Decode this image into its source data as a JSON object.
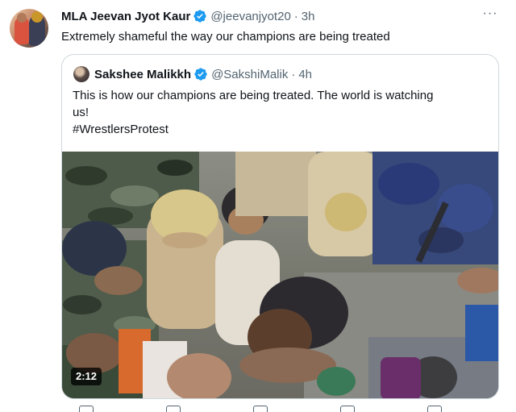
{
  "tweet": {
    "author_name": "MLA Jeevan Jyot Kaur",
    "handle": "@jeevanjyot20",
    "separator": "·",
    "time": "3h",
    "more_label": "···",
    "text": "Extremely shameful the way our champions are being treated",
    "verified_color": "#1d9bf0"
  },
  "quoted": {
    "author_name": "Sakshee Malikkh",
    "handle": "@SakshiMalik",
    "separator": "·",
    "time": "4h",
    "text_line1": "This is how our champions are being treated. The world is watching",
    "text_line2": "us!",
    "hashtag": "#WrestlersProtest",
    "media": {
      "type": "video",
      "duration": "2:12"
    }
  },
  "icons": [
    "verified-badge-icon",
    "more-icon",
    "reply-icon",
    "retweet-icon",
    "like-icon",
    "views-icon",
    "share-icon"
  ]
}
